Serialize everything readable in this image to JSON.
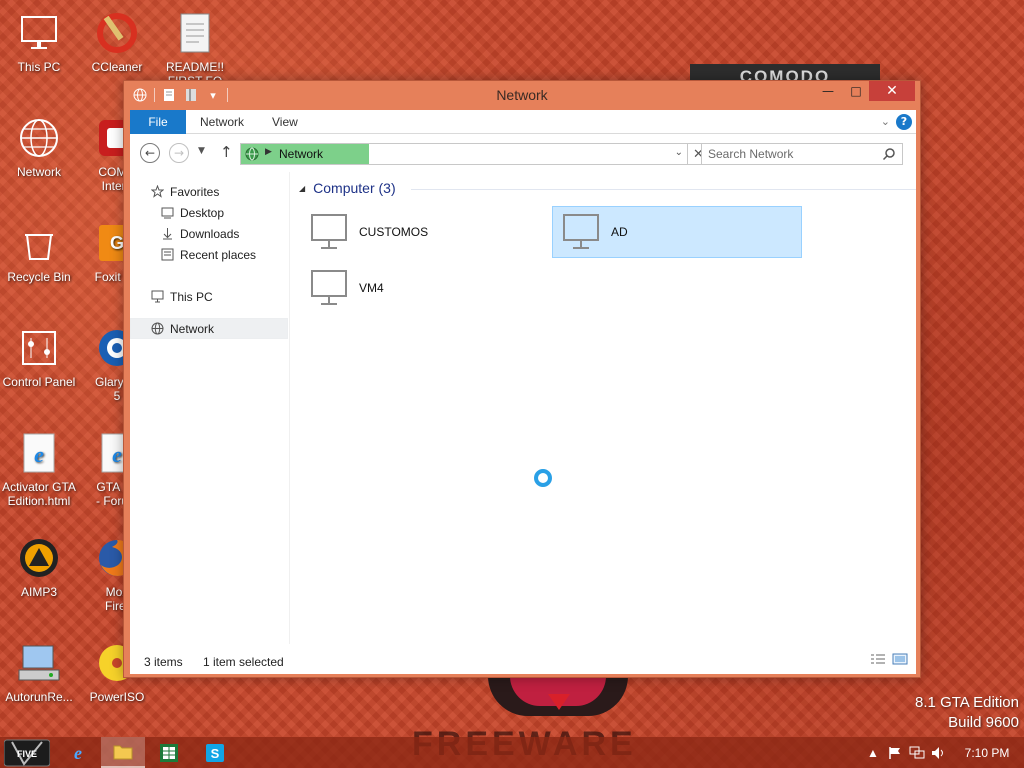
{
  "desktop": {
    "icons": [
      {
        "label": "This PC"
      },
      {
        "label": "CCleaner"
      },
      {
        "label": "README!!\nFIRST FO"
      },
      {
        "label": "Network"
      },
      {
        "label": "COMO\nIntern"
      },
      {
        "label": "Recycle Bin"
      },
      {
        "label": "Foxit Re"
      },
      {
        "label": "Control Panel"
      },
      {
        "label": "Glary Ut\n5"
      },
      {
        "label": "Activator GTA\nEdition.html"
      },
      {
        "label": "GTA Su\n- Forum"
      },
      {
        "label": "AIMP3"
      },
      {
        "label": "Moz\nFiref"
      },
      {
        "label": "AutorunRe..."
      },
      {
        "label": "PowerISO"
      }
    ],
    "banner": "COMODO",
    "watermark": "FREEWARE",
    "edition_line1": "8.1 GTA Edition",
    "edition_line2": "Build 9600"
  },
  "window": {
    "title": "Network",
    "ribbon": {
      "file": "File",
      "network": "Network",
      "view": "View"
    },
    "address": {
      "crumb": "Network"
    },
    "search": {
      "placeholder": "Search Network"
    },
    "nav": {
      "favorites": "Favorites",
      "desktop": "Desktop",
      "downloads": "Downloads",
      "recent": "Recent places",
      "this_pc": "This PC",
      "network": "Network"
    },
    "group": {
      "title": "Computer (3)"
    },
    "computers": [
      {
        "name": "CUSTOMOS",
        "selected": false
      },
      {
        "name": "AD",
        "selected": true
      },
      {
        "name": "VM4",
        "selected": false
      }
    ],
    "status": {
      "items": "3 items",
      "selected": "1 item selected"
    }
  },
  "taskbar": {
    "start_label": "FIVE",
    "clock": "7:10 PM"
  },
  "colors": {
    "accent": "#1979ca",
    "window_frame": "#e6805a",
    "close": "#c7403a",
    "selection": "#cce8ff",
    "crumb": "#7dd08a"
  }
}
